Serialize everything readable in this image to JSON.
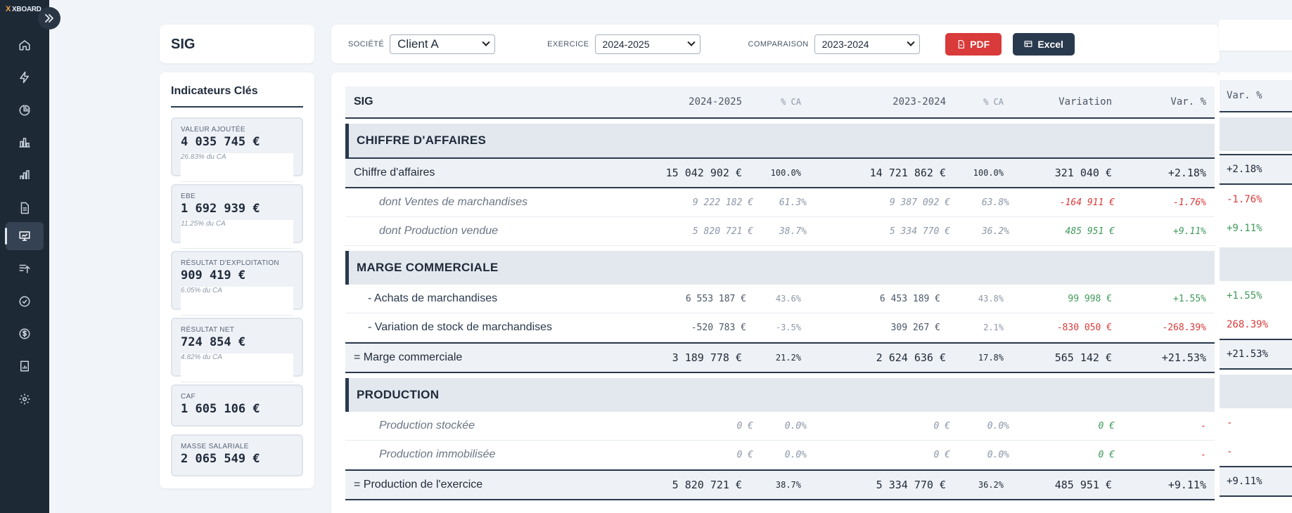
{
  "app": {
    "logo_mark": "X",
    "logo_text": "XBOARD"
  },
  "sidebar": {
    "items": [
      {
        "icon": "home-icon"
      },
      {
        "icon": "lightning-icon"
      },
      {
        "icon": "pie-chart-icon"
      },
      {
        "icon": "bar-chart-icon"
      },
      {
        "icon": "bar-chart-alt-icon"
      },
      {
        "icon": "document-icon"
      },
      {
        "icon": "presentation-chart-icon",
        "active": true
      },
      {
        "icon": "sort-upload-icon"
      },
      {
        "icon": "check-circle-icon"
      },
      {
        "icon": "dollar-circle-icon"
      },
      {
        "icon": "report-icon"
      },
      {
        "icon": "gear-icon"
      }
    ]
  },
  "page": {
    "title": "SIG"
  },
  "indicators": {
    "title": "Indicateurs Clés",
    "items": [
      {
        "label": "VALEUR AJOUTÉE",
        "value": "4 035 745 €",
        "sub": "26.83% du CA"
      },
      {
        "label": "EBE",
        "value": "1 692 939 €",
        "sub": "11.25% du CA"
      },
      {
        "label": "RÉSULTAT D'EXPLOITATION",
        "value": "909 419 €",
        "sub": "6.05% du CA"
      },
      {
        "label": "RÉSULTAT NET",
        "value": "724 854 €",
        "sub": "4.82% du CA"
      },
      {
        "label": "CAF",
        "value": "1 605 106 €",
        "sub": ""
      },
      {
        "label": "MASSE SALARIALE",
        "value": "2 065 549 €",
        "sub": ""
      }
    ]
  },
  "filters": {
    "societe_label": "SOCIÉTÉ",
    "societe_value": "Client A",
    "exercice_label": "EXERCICE",
    "exercice_value": "2024-2025",
    "comparaison_label": "COMPARAISON",
    "comparaison_value": "2023-2024",
    "pdf_label": "PDF",
    "excel_label": "Excel"
  },
  "table": {
    "headers": {
      "label": "SIG",
      "current": "2024-2025",
      "pct_current": "% CA",
      "previous": "2023-2024",
      "pct_previous": "% CA",
      "variation": "Variation",
      "var_pct": "Var. %"
    },
    "rows": [
      {
        "type": "section",
        "label": "CHIFFRE D'AFFAIRES"
      },
      {
        "type": "total",
        "label": "Chiffre d'affaires",
        "cur": "15 042 902 €",
        "pcur": "100.0%",
        "prev": "14 721 862 €",
        "pprev": "100.0%",
        "var": "321 040 €",
        "varp": "+2.18%",
        "tone": "neutral"
      },
      {
        "type": "sub",
        "label": "dont Ventes de marchandises",
        "cur": "9 222 182 €",
        "pcur": "61.3%",
        "prev": "9 387 092 €",
        "pprev": "63.8%",
        "var": "-164 911 €",
        "varp": "-1.76%",
        "tone": "neg"
      },
      {
        "type": "sub",
        "label": "dont Production vendue",
        "cur": "5 820 721 €",
        "pcur": "38.7%",
        "prev": "5 334 770 €",
        "pprev": "36.2%",
        "var": "485 951 €",
        "varp": "+9.11%",
        "tone": "pos"
      },
      {
        "type": "section",
        "label": "MARGE COMMERCIALE"
      },
      {
        "type": "line",
        "label": "- Achats de marchandises",
        "cur": "6 553 187 €",
        "pcur": "43.6%",
        "prev": "6 453 189 €",
        "pprev": "43.8%",
        "var": "99 998 €",
        "varp": "+1.55%",
        "tone": "pos"
      },
      {
        "type": "line",
        "label": "- Variation de stock de marchandises",
        "cur": "-520 783 €",
        "pcur": "-3.5%",
        "prev": "309 267 €",
        "pprev": "2.1%",
        "var": "-830 050 €",
        "varp": "-268.39%",
        "tone": "neg"
      },
      {
        "type": "total",
        "label": "= Marge commerciale",
        "cur": "3 189 778 €",
        "pcur": "21.2%",
        "prev": "2 624 636 €",
        "pprev": "17.8%",
        "var": "565 142 €",
        "varp": "+21.53%",
        "tone": "neutral"
      },
      {
        "type": "section",
        "label": "PRODUCTION"
      },
      {
        "type": "sub",
        "label": "Production stockée",
        "cur": "0 €",
        "pcur": "0.0%",
        "prev": "0 €",
        "pprev": "0.0%",
        "var": "0 €",
        "varp": "-",
        "tone": "posdash"
      },
      {
        "type": "sub",
        "label": "Production immobilisée",
        "cur": "0 €",
        "pcur": "0.0%",
        "prev": "0 €",
        "pprev": "0.0%",
        "var": "0 €",
        "varp": "-",
        "tone": "posdash"
      },
      {
        "type": "total",
        "label": "= Production de l'exercice",
        "cur": "5 820 721 €",
        "pcur": "38.7%",
        "prev": "5 334 770 €",
        "pprev": "36.2%",
        "var": "485 951 €",
        "varp": "+9.11%",
        "tone": "neutral"
      }
    ],
    "clipped_column": {
      "header": "Var. %",
      "values": [
        "+2.18%",
        "-1.76%",
        "+9.11%",
        "+1.55%",
        "268.39%",
        "+21.53%",
        "-",
        "-",
        "+9.11%"
      ]
    }
  }
}
